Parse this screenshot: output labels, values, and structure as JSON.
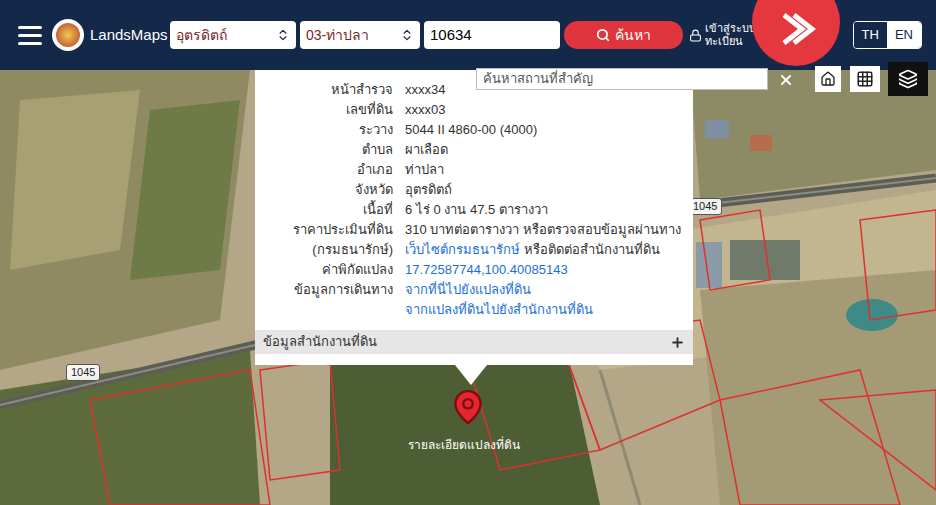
{
  "header": {
    "brand": "LandsMaps",
    "province_select": "อุตรดิตถ์",
    "district_select": "03-ท่าปลา",
    "parcel_input": "10634",
    "search_button": "ค้นหา",
    "login_lines": [
      "เข้าสู่ระบบ",
      "ทะเบียน"
    ],
    "languages": [
      {
        "label": "TH",
        "selected": false
      },
      {
        "label": "EN",
        "selected": true
      }
    ]
  },
  "map_search": {
    "placeholder": "ค้นหาสถานที่สำคัญ"
  },
  "popup": {
    "rows": [
      {
        "label": "หน้าสำรวจ",
        "lines": [
          [
            {
              "text": "xxxx34",
              "link": false
            }
          ]
        ]
      },
      {
        "label": "เลขที่ดิน",
        "lines": [
          [
            {
              "text": "xxxx03",
              "link": false
            }
          ]
        ]
      },
      {
        "label": "ระวาง",
        "lines": [
          [
            {
              "text": "5044 II 4860-00 (4000)",
              "link": false
            }
          ]
        ]
      },
      {
        "label": "ตำบล",
        "lines": [
          [
            {
              "text": "ผาเลือด",
              "link": false
            }
          ]
        ]
      },
      {
        "label": "อำเภอ",
        "lines": [
          [
            {
              "text": "ท่าปลา",
              "link": false
            }
          ]
        ]
      },
      {
        "label": "จังหวัด",
        "lines": [
          [
            {
              "text": "อุตรดิตถ์",
              "link": false
            }
          ]
        ]
      },
      {
        "label": "เนื้อที่",
        "lines": [
          [
            {
              "text": "6 ไร่ 0 งาน 47.5 ตารางวา",
              "link": false
            }
          ]
        ]
      },
      {
        "label": "ราคาประเมินที่ดิน",
        "lines": [
          [
            {
              "text": "310 บาทต่อตารางวา หรือตรวจสอบข้อมูลผ่านทาง",
              "link": false
            }
          ]
        ]
      },
      {
        "label": "(กรมธนารักษ์)",
        "lines": [
          [
            {
              "text": "เว็บไซต์กรมธนารักษ์",
              "link": true
            },
            {
              "text": " หรือติดต่อสำนักงานที่ดิน",
              "link": false
            }
          ]
        ]
      },
      {
        "label": "ค่าพิกัดแปลง",
        "lines": [
          [
            {
              "text": "17.72587744,100.40085143",
              "link": true
            }
          ]
        ]
      },
      {
        "label": "ข้อมูลการเดินทาง",
        "lines": [
          [
            {
              "text": "จากที่นี่ไปยังแปลงที่ดิน",
              "link": true
            }
          ],
          [
            {
              "text": "จากแปลงที่ดินไปยังสำนักงานที่ดิน",
              "link": true
            }
          ]
        ]
      }
    ],
    "accordion": {
      "label": "ข้อมูลสำนักงานที่ดิน",
      "expanded": false
    }
  },
  "road_labels": [
    "1045",
    "1045"
  ],
  "pin_label": "รายละเอียดแปลงที่ดิน"
}
